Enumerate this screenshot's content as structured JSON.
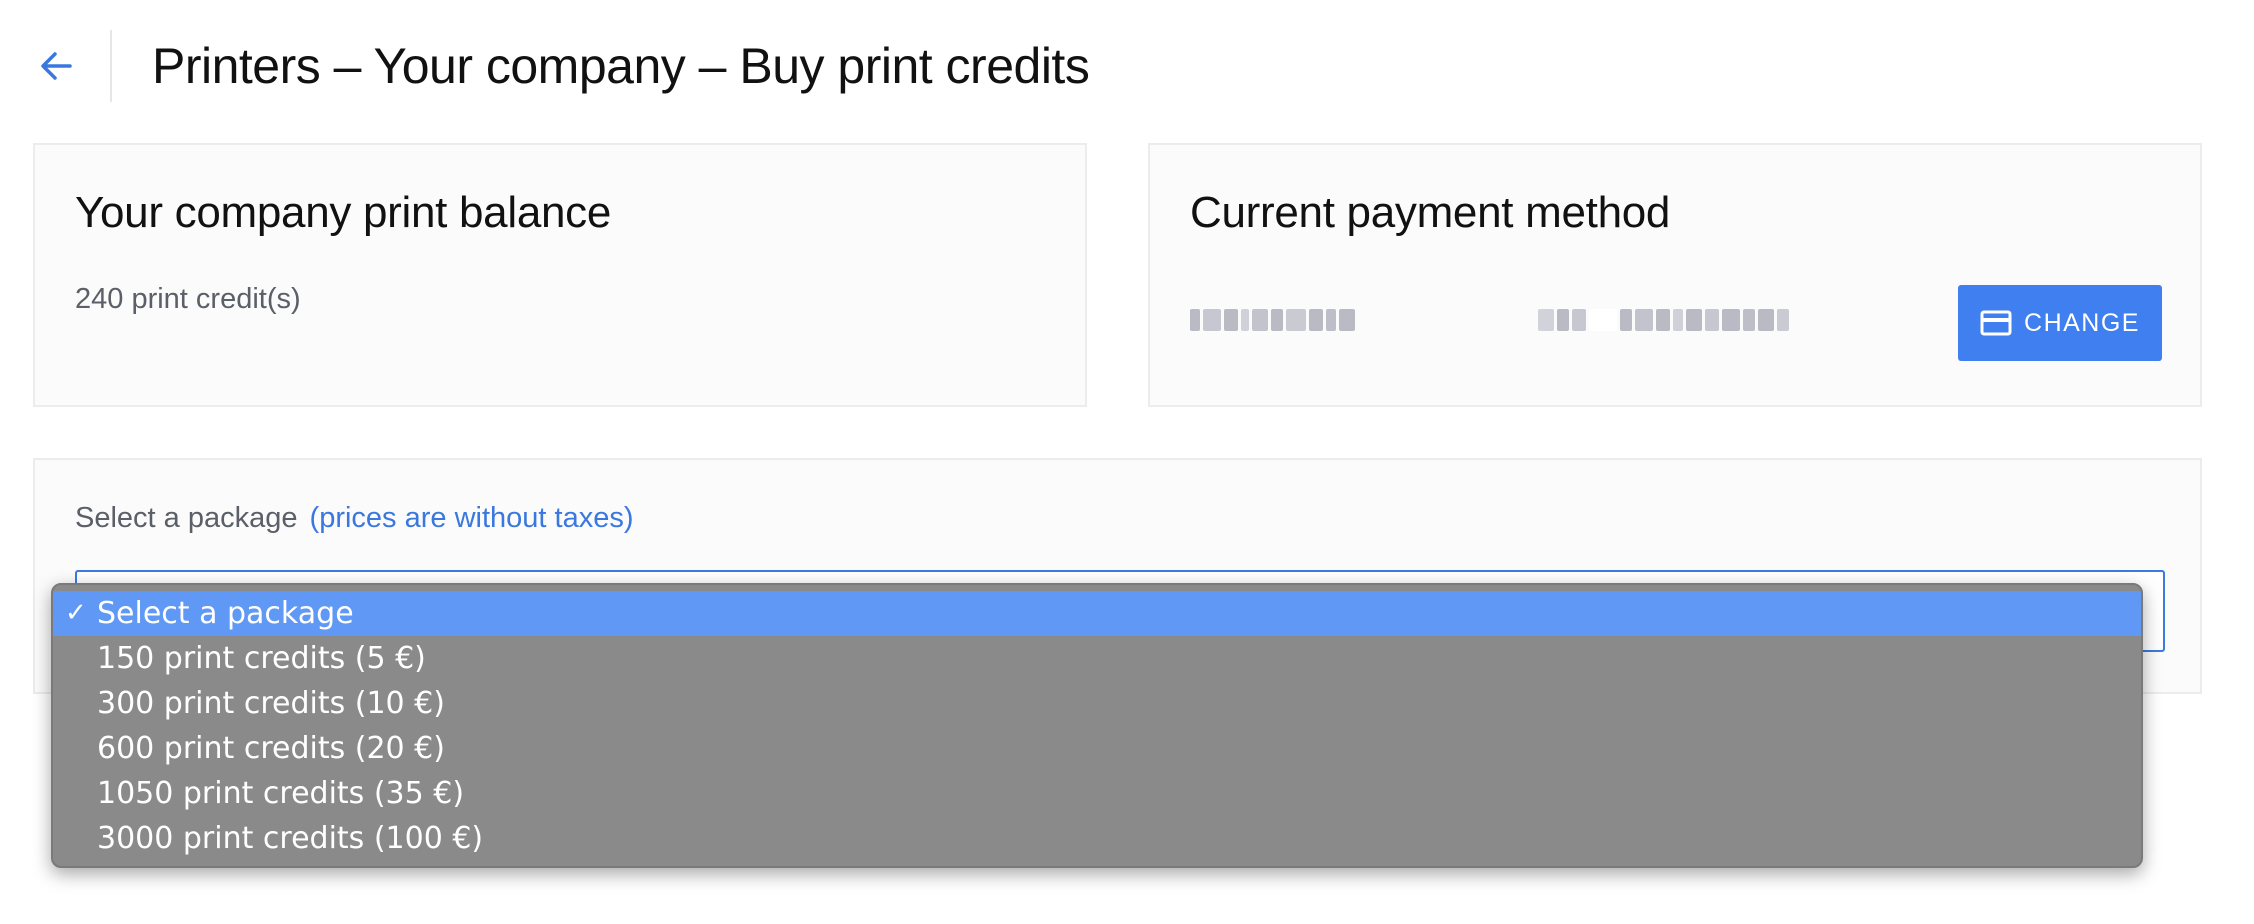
{
  "header": {
    "title": "Printers – Your company – Buy print credits",
    "back_icon": "arrow-left-icon"
  },
  "balance_card": {
    "title": "Your company print balance",
    "value": "240 print credit(s)"
  },
  "payment_card": {
    "title": "Current payment method",
    "change_label": "CHANGE",
    "change_icon": "credit-card-icon"
  },
  "package_card": {
    "label": "Select a package",
    "hint": "(prices are without taxes)"
  },
  "dropdown": {
    "selected_index": 0,
    "check": "✓",
    "options": [
      "Select a package",
      "150 print credits (5 €)",
      "300 print credits (10 €)",
      "600 print credits (20 €)",
      "1050 print credits (35 €)",
      "3000 print credits (100 €)"
    ]
  },
  "colors": {
    "accent": "#3f7ff0",
    "hint_text": "#3a78e0",
    "menu_bg": "#8a8a8a",
    "menu_selected": "#5f98f5"
  }
}
